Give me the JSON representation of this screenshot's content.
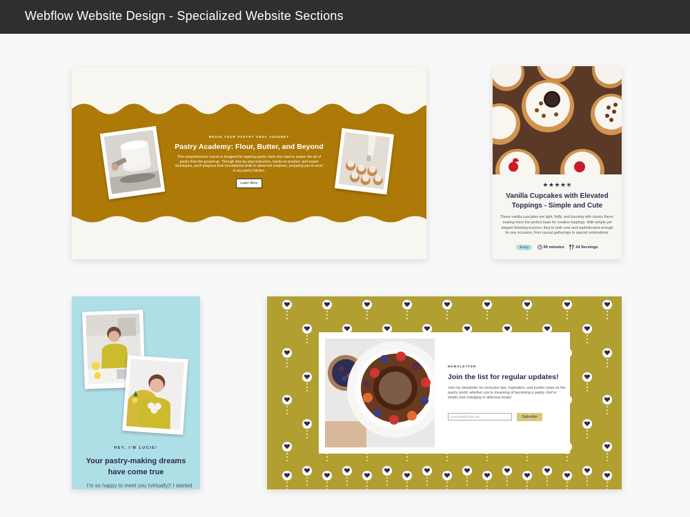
{
  "page": {
    "title": "Webflow Website Design - Specialized Website Sections"
  },
  "academy": {
    "kicker": "BEGIN YOUR PASTRY CHEF JOURNEY",
    "title": "Pastry Academy: Flour, Butter, and Beyond",
    "body": "This comprehensive course is designed for aspiring pastry chefs who want to master the art of pastry from the ground up. Through step-by-step instruction, hands-on practice, and expert techniques, you'll progress from foundational skills to advanced creations, preparing you to excel in any pastry kitchen.",
    "button": "Learn More",
    "colors": {
      "band": "#ad7a07",
      "cream": "#f8f6f1"
    }
  },
  "cupcake": {
    "rating": 4.5,
    "stars": "★★★★✬",
    "title": "Vanilla Cupcakes with Elevated Toppings - Simple and Cute",
    "body": "These vanilla cupcakes are light, fluffy, and bursting with classic flavor, making them the perfect base for creative toppings. With simple yet elegant finishing touches, they're both cute and sophisticated enough for any occasion, from casual gatherings to special celebrations.",
    "difficulty": "Easy",
    "time": "90 minutes",
    "servings": "24 Servings",
    "time_icon": "clock-icon",
    "servings_icon": "utensils-icon"
  },
  "lucie": {
    "kicker": "HEY, I'M LUCIE!",
    "title": "Your pastry-making dreams have come true",
    "body": "I'm so happy to meet you (virtually)! I started",
    "colors": {
      "bg": "#afdfe6"
    }
  },
  "newsletter": {
    "kicker": "NEWSLETTER",
    "title": "Join the list for regular updates!",
    "body": "Join my newsletter for exclusive tips, inspiration, and insider news on the pastry world, whether you're dreaming of becoming a pastry chef or simply love indulging in delicious treats!",
    "email_placeholder": "youremail@email.com",
    "button": "Subscribe",
    "colors": {
      "bg": "#b1a031",
      "button": "#d8c97a"
    }
  }
}
